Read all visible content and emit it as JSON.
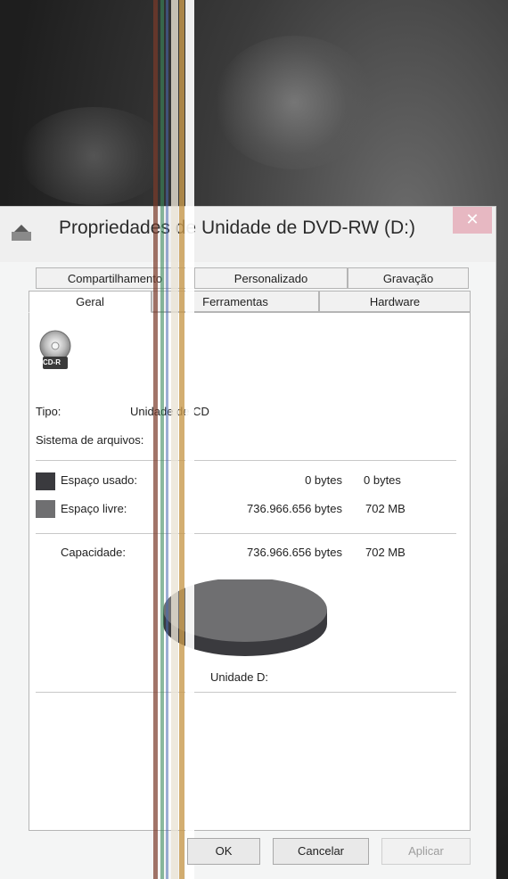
{
  "window": {
    "title": "Propriedades de Unidade de DVD-RW (D:)",
    "close_glyph": "✕"
  },
  "tabs_row1": [
    {
      "label": "Compartilhamento"
    },
    {
      "label": "Personalizado"
    },
    {
      "label": "Gravação"
    }
  ],
  "tabs_row2": [
    {
      "label": "Geral"
    },
    {
      "label": "Ferramentas"
    },
    {
      "label": "Hardware"
    }
  ],
  "active_tab": "Geral",
  "drive": {
    "icon_label": "CD-R",
    "type_label": "Tipo:",
    "type_value": "Unidade de CD",
    "fs_label": "Sistema de arquivos:",
    "used": {
      "label": "Espaço usado:",
      "bytes": "0 bytes",
      "size": "0 bytes",
      "color": "#3a3a3e"
    },
    "free": {
      "label": "Espaço livre:",
      "bytes": "736.966.656 bytes",
      "size": "702 MB",
      "color": "#6f6f71"
    },
    "capacity": {
      "label": "Capacidade:",
      "bytes": "736.966.656 bytes",
      "size": "702 MB"
    },
    "drive_label": "Unidade D:"
  },
  "buttons": {
    "ok": "OK",
    "cancel": "Cancelar",
    "apply": "Aplicar"
  }
}
